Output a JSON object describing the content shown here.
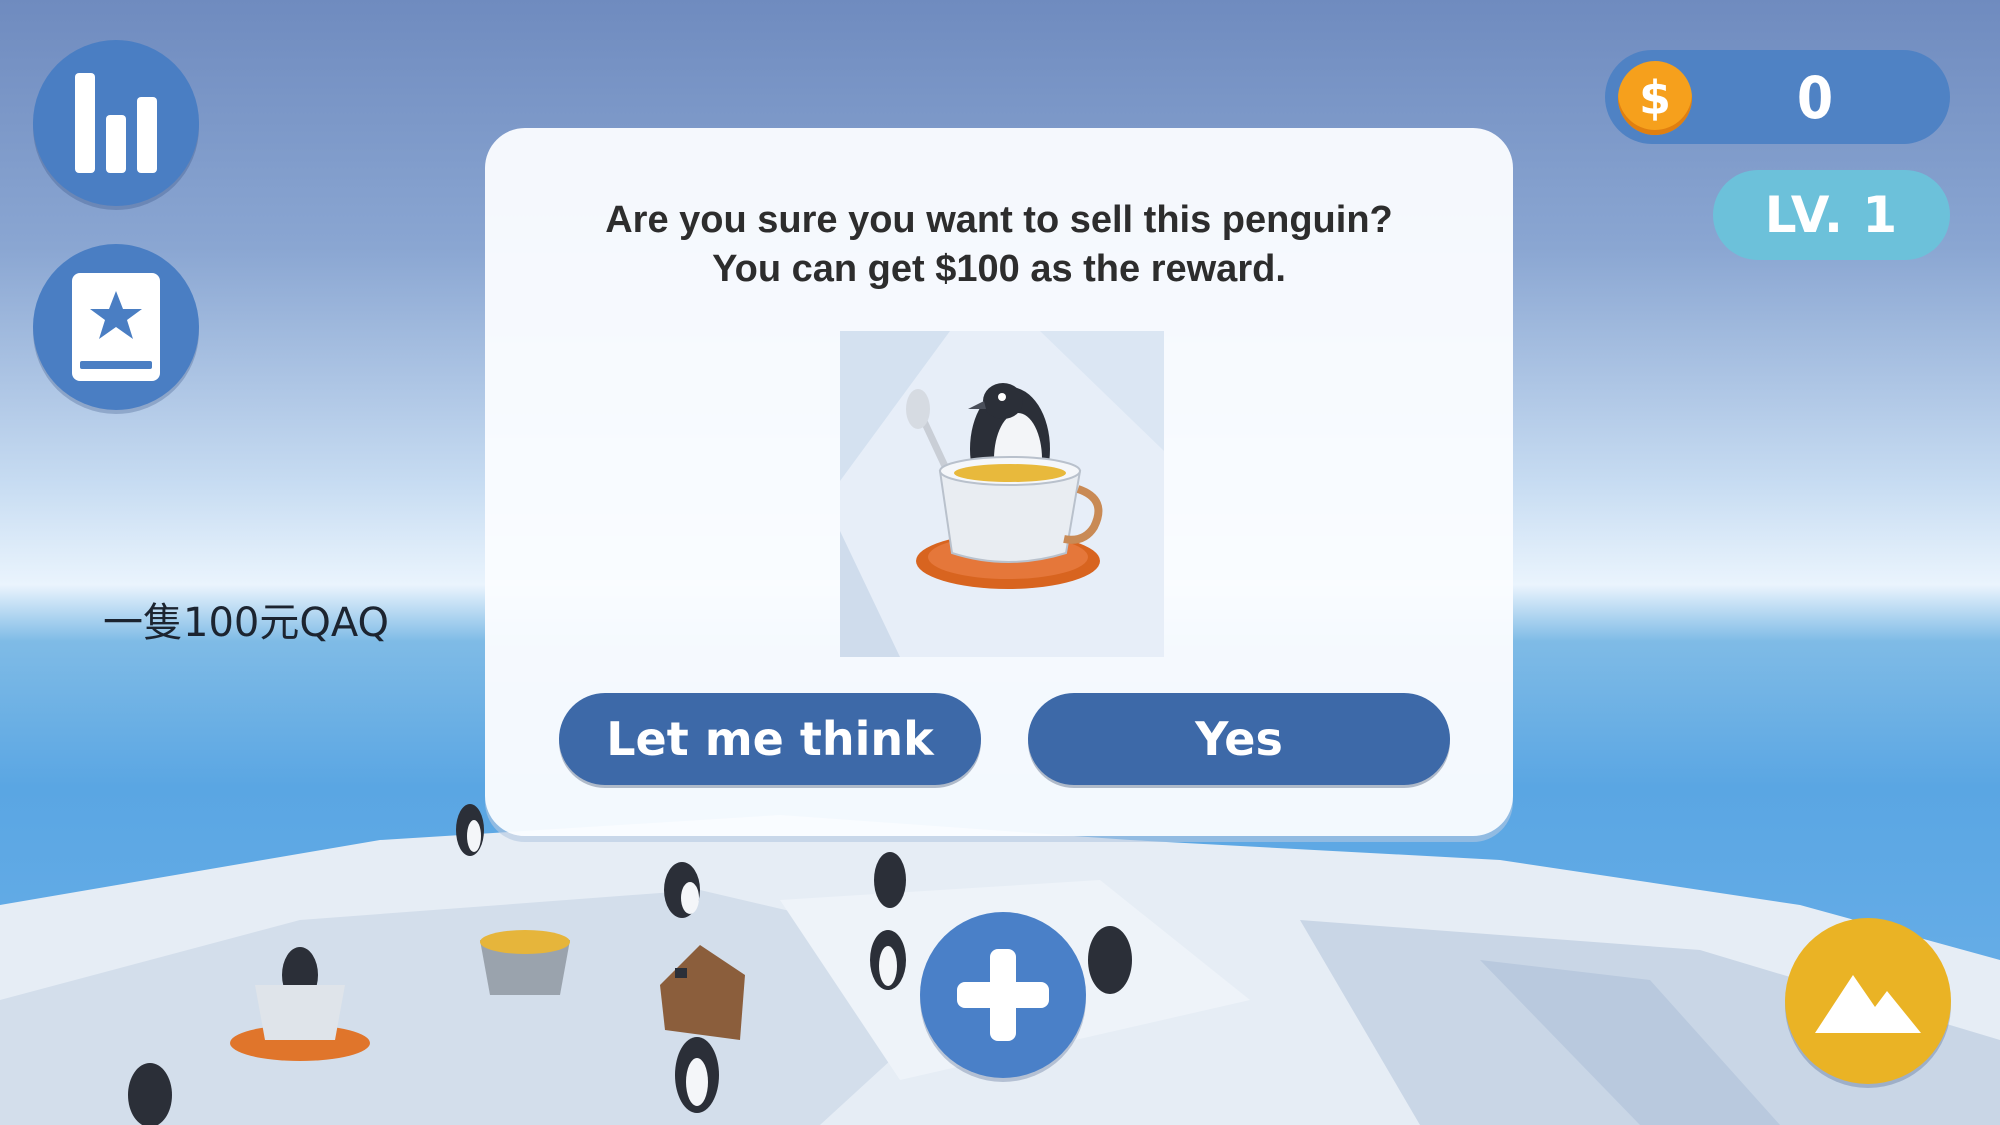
{
  "hud": {
    "stats_icon": "bar-chart-icon",
    "collection_icon": "star-book-icon",
    "add_icon": "plus-icon",
    "map_icon": "mountain-icon",
    "money_symbol": "$",
    "money": "0",
    "level": "LV. 1"
  },
  "caption": "一隻100元QAQ",
  "dialog": {
    "line1": "Are you sure you want to sell this penguin?",
    "line2": "You can get $100 as the reward.",
    "preview_label": "penguin-in-teacup",
    "cancel_label": "Let me think",
    "confirm_label": "Yes"
  },
  "colors": {
    "primary_blue": "#4a7ec3",
    "button_blue": "#3d69a8",
    "level_teal": "#6cc1da",
    "coin_orange": "#f6a01c",
    "map_yellow": "#eab325"
  }
}
